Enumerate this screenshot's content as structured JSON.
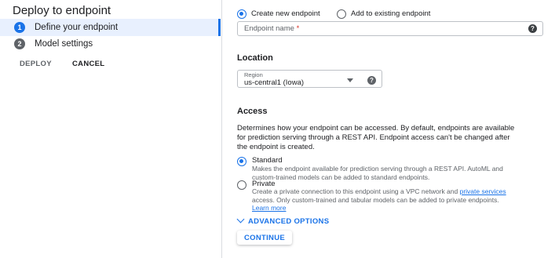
{
  "title": "Deploy to endpoint",
  "steps": [
    {
      "num": "1",
      "label": "Define your endpoint"
    },
    {
      "num": "2",
      "label": "Model settings"
    }
  ],
  "actions": {
    "deploy": "DEPLOY",
    "cancel": "CANCEL"
  },
  "endpoint_mode": {
    "create_new": "Create new endpoint",
    "add_existing": "Add to existing endpoint",
    "selected": "Create new endpoint"
  },
  "endpoint_name": {
    "label": "Endpoint name",
    "required_mark": "*",
    "value": ""
  },
  "location": {
    "title": "Location",
    "region_label": "Region",
    "region_value": "us-central1 (Iowa)"
  },
  "access": {
    "title": "Access",
    "description_lines": [
      "Determines how your endpoint can be accessed. By default, endpoints are available",
      "for prediction serving through a REST API. Endpoint access can't be changed after",
      "the endpoint is created."
    ],
    "selected": "Standard",
    "standard": {
      "label": "Standard",
      "desc_lines": [
        "Makes the endpoint available for prediction serving through a REST API. AutoML and",
        "custom-trained models can be added to standard endpoints."
      ]
    },
    "private": {
      "label": "Private",
      "desc_line1_pre": "Create a private connection to this endpoint using a VPC network and ",
      "desc_line1_link": "private services",
      "desc_line2": "access. Only custom-trained and tabular models can be added to private endpoints.",
      "learn_more": "Learn more"
    }
  },
  "advanced_options": "ADVANCED OPTIONS",
  "continue": "CONTINUE",
  "colors": {
    "accent": "#1a73e8",
    "active_step_bg": "#e8f0fe",
    "text": "#202124",
    "muted": "#5f6368"
  }
}
